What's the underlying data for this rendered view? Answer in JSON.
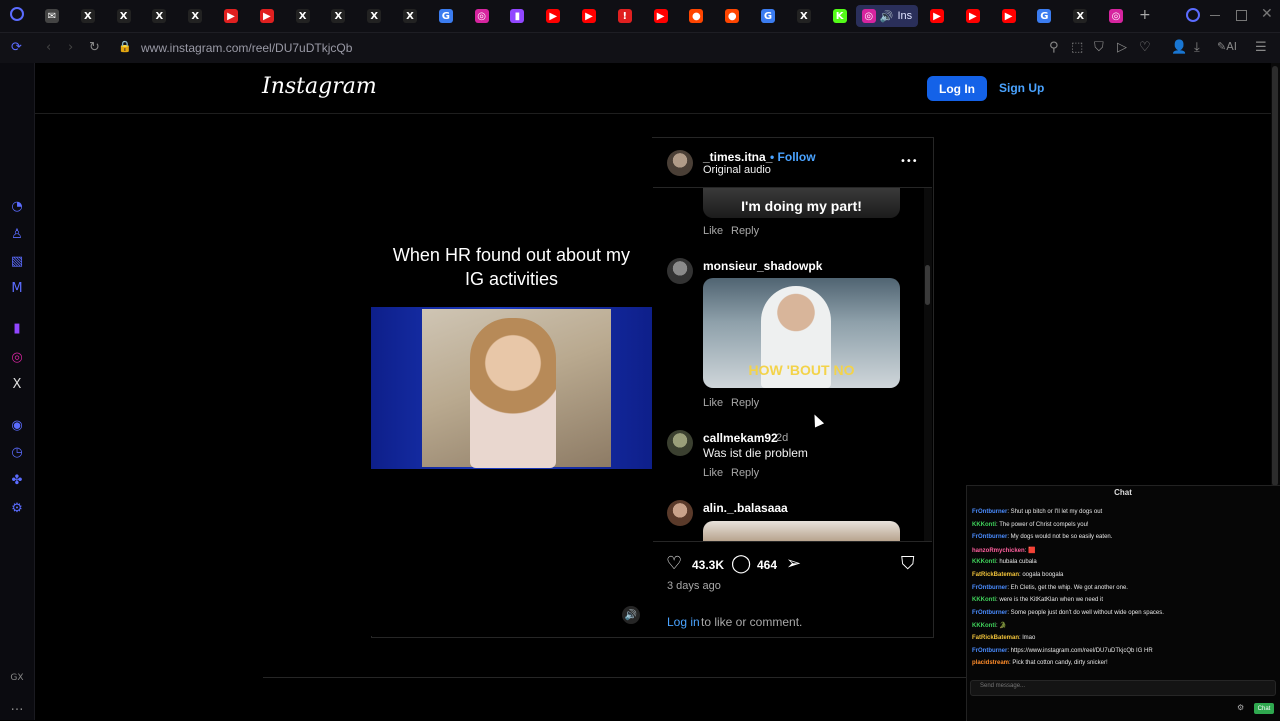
{
  "browser": {
    "tabs": [
      {
        "icon": "mail-icon",
        "glyph": "✉",
        "color": "#444"
      },
      {
        "icon": "x-icon",
        "glyph": "X",
        "color": "#222"
      },
      {
        "icon": "x-icon",
        "glyph": "X",
        "color": "#222"
      },
      {
        "icon": "x-icon",
        "glyph": "X",
        "color": "#222"
      },
      {
        "icon": "x-icon",
        "glyph": "X",
        "color": "#222"
      },
      {
        "icon": "play-icon",
        "glyph": "▶",
        "color": "#e02020"
      },
      {
        "icon": "play-icon",
        "glyph": "▶",
        "color": "#e02020"
      },
      {
        "icon": "x-icon",
        "glyph": "X",
        "color": "#222"
      },
      {
        "icon": "x-icon",
        "glyph": "X",
        "color": "#222"
      },
      {
        "icon": "x-icon",
        "glyph": "X",
        "color": "#222"
      },
      {
        "icon": "x-icon",
        "glyph": "X",
        "color": "#222"
      },
      {
        "icon": "google-icon",
        "glyph": "G",
        "color": "#3b7cf0"
      },
      {
        "icon": "instagram-icon",
        "glyph": "◎",
        "color": "#d6249f"
      },
      {
        "icon": "twitch-icon",
        "glyph": "▮",
        "color": "#9146ff"
      },
      {
        "icon": "youtube-icon",
        "glyph": "▶",
        "color": "#ff0000"
      },
      {
        "icon": "youtube-icon",
        "glyph": "▶",
        "color": "#ff0000"
      },
      {
        "icon": "alert-icon",
        "glyph": "!",
        "color": "#e02020"
      },
      {
        "icon": "youtube-icon",
        "glyph": "▶",
        "color": "#ff0000"
      },
      {
        "icon": "reddit-icon",
        "glyph": "●",
        "color": "#ff4500"
      },
      {
        "icon": "reddit-icon",
        "glyph": "●",
        "color": "#ff4500"
      },
      {
        "icon": "google-icon",
        "glyph": "G",
        "color": "#3b7cf0"
      },
      {
        "icon": "x-icon",
        "glyph": "X",
        "color": "#222"
      },
      {
        "icon": "kick-icon",
        "glyph": "K",
        "color": "#53fc18"
      }
    ],
    "active_tab": {
      "icon": "instagram-icon",
      "audio_icon": "speaker-icon",
      "title": "Ins"
    },
    "tabs_right": [
      {
        "icon": "youtube-icon",
        "glyph": "▶",
        "color": "#ff0000"
      },
      {
        "icon": "youtube-icon",
        "glyph": "▶",
        "color": "#ff0000"
      },
      {
        "icon": "youtube-icon",
        "glyph": "▶",
        "color": "#ff0000"
      },
      {
        "icon": "google-icon",
        "glyph": "G",
        "color": "#3b7cf0"
      },
      {
        "icon": "x-icon",
        "glyph": "X",
        "color": "#222"
      },
      {
        "icon": "instagram-icon",
        "glyph": "◎",
        "color": "#d6249f"
      }
    ],
    "new_tab_glyph": "+",
    "url": "www.instagram.com/reel/DU7uDTkjcQb",
    "accent": "#5b6cff"
  },
  "header": {
    "logo": "Instagram",
    "login_label": "Log In",
    "signup_label": "Sign Up",
    "login_color": "#1462e8"
  },
  "post": {
    "video_caption": "When HR found out about my IG activities",
    "watermark": "",
    "username": "_times.itna_",
    "follow_label": "• Follow",
    "audio": "Original audio",
    "more_glyph": "•••",
    "comments": [
      {
        "gif_text": "I'm doing my part!",
        "like": "Like",
        "reply": "Reply"
      },
      {
        "user": "monsieur_shadowpk",
        "gif_text": "HOW 'BOUT NO",
        "like": "Like",
        "reply": "Reply"
      },
      {
        "user": "callmekam92",
        "time": "2d",
        "text": "Was ist die problem",
        "like": "Like",
        "reply": "Reply"
      },
      {
        "user": "alin._.balasaaa"
      }
    ],
    "likes": "43.3K",
    "comment_count": "464",
    "posted": "3 days ago",
    "login_link": "Log in",
    "login_rest": "to like or comment."
  },
  "chat": {
    "title": "Chat",
    "lines": [
      {
        "name": "FrOntburner",
        "color": "#4a8cff",
        "text": ": Shut up bitch or I'll let my dogs out"
      },
      {
        "name": "KKKonti",
        "color": "#3fd05a",
        "text": ": The power of Christ compels you!"
      },
      {
        "name": "FrOntburner",
        "color": "#4a8cff",
        "text": ": My dogs would not be so easily eaten."
      },
      {
        "name": "hanzoRmychicken",
        "color": "#ff5f9e",
        "text": ": 🟥"
      },
      {
        "name": "KKKonti",
        "color": "#3fd05a",
        "text": ": hubala cubala"
      },
      {
        "name": "FatRickBateman",
        "color": "#f0c23a",
        "text": ": oogala boogala"
      },
      {
        "name": "FrOntburner",
        "color": "#4a8cff",
        "text": ": Eh Cletis, get the whip. We got another one."
      },
      {
        "name": "KKKonti",
        "color": "#3fd05a",
        "text": ": were is the KitKatKlan when we need it"
      },
      {
        "name": "FrOntburner",
        "color": "#4a8cff",
        "text": ": Some people just don't do well without wide open spaces."
      },
      {
        "name": "KKKonti",
        "color": "#3fd05a",
        "text": ": 🐊"
      },
      {
        "name": "FatRickBateman",
        "color": "#f0c23a",
        "text": ": lmao"
      },
      {
        "name": "FrOntburner",
        "color": "#4a8cff",
        "text": ": https://www.instagram.com/reel/DU7uDTkjcQb IG HR"
      },
      {
        "name": "placidstream",
        "color": "#ff8c2a",
        "text": ": Pick that cotton candy, dirty snicker!"
      }
    ],
    "input_placeholder": "Send message...",
    "send_label": "Chat",
    "gear_glyph": "⚙"
  }
}
